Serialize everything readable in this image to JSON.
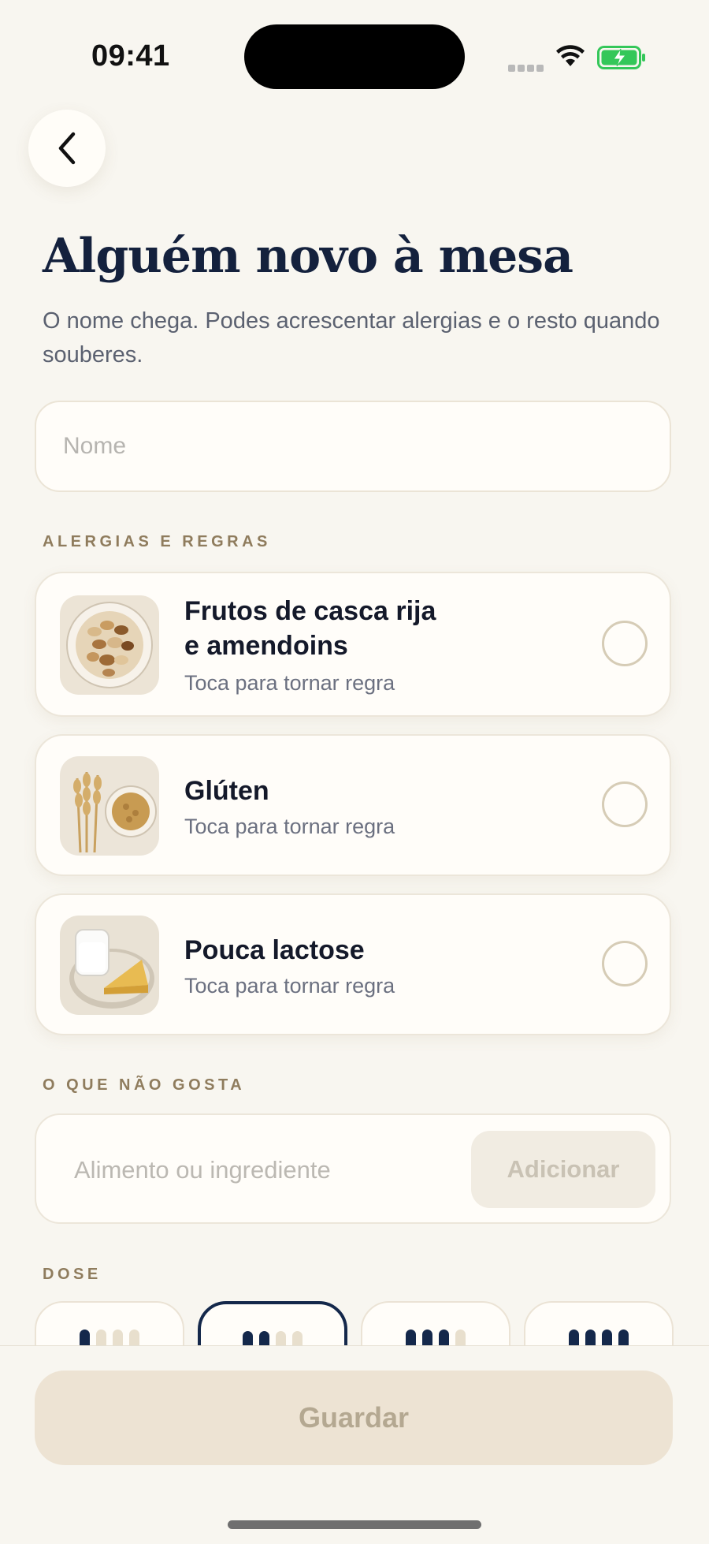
{
  "status_bar": {
    "time": "09:41"
  },
  "header": {
    "back_icon": "chevron-left-icon",
    "title": "Alguém novo à mesa",
    "subtitle": "O nome chega. Podes acrescentar alergias e o resto quando souberes."
  },
  "name_field": {
    "placeholder": "Nome",
    "value": ""
  },
  "allergies": {
    "label": "ALERGIAS E REGRAS",
    "items": [
      {
        "title_line1": "Frutos de casca rija",
        "title_line2": "e amendoins",
        "hint": "Toca para tornar regra",
        "selected": false,
        "image": "nuts-bowl"
      },
      {
        "title_line1": "Glúten",
        "title_line2": "",
        "hint": "Toca para tornar regra",
        "selected": false,
        "image": "wheat-and-grains"
      },
      {
        "title_line1": "Pouca lactose",
        "title_line2": "",
        "hint": "Toca para tornar regra",
        "selected": false,
        "image": "milk-and-cheese"
      }
    ]
  },
  "dislikes": {
    "label": "O QUE NÃO GOSTA",
    "placeholder": "Alimento ou ingrediente",
    "add_label": "Adicionar"
  },
  "dose": {
    "label": "DOSE",
    "options": [
      {
        "level": 1,
        "of": 4,
        "selected": false
      },
      {
        "level": 2,
        "of": 4,
        "selected": true
      },
      {
        "level": 3,
        "of": 4,
        "selected": false
      },
      {
        "level": 4,
        "of": 4,
        "selected": false
      }
    ]
  },
  "footer": {
    "save_label": "Guardar"
  },
  "colors": {
    "background": "#f8f6f0",
    "navy": "#14284b",
    "label_tan": "#8f7c5d",
    "battery_green": "#34c759"
  }
}
